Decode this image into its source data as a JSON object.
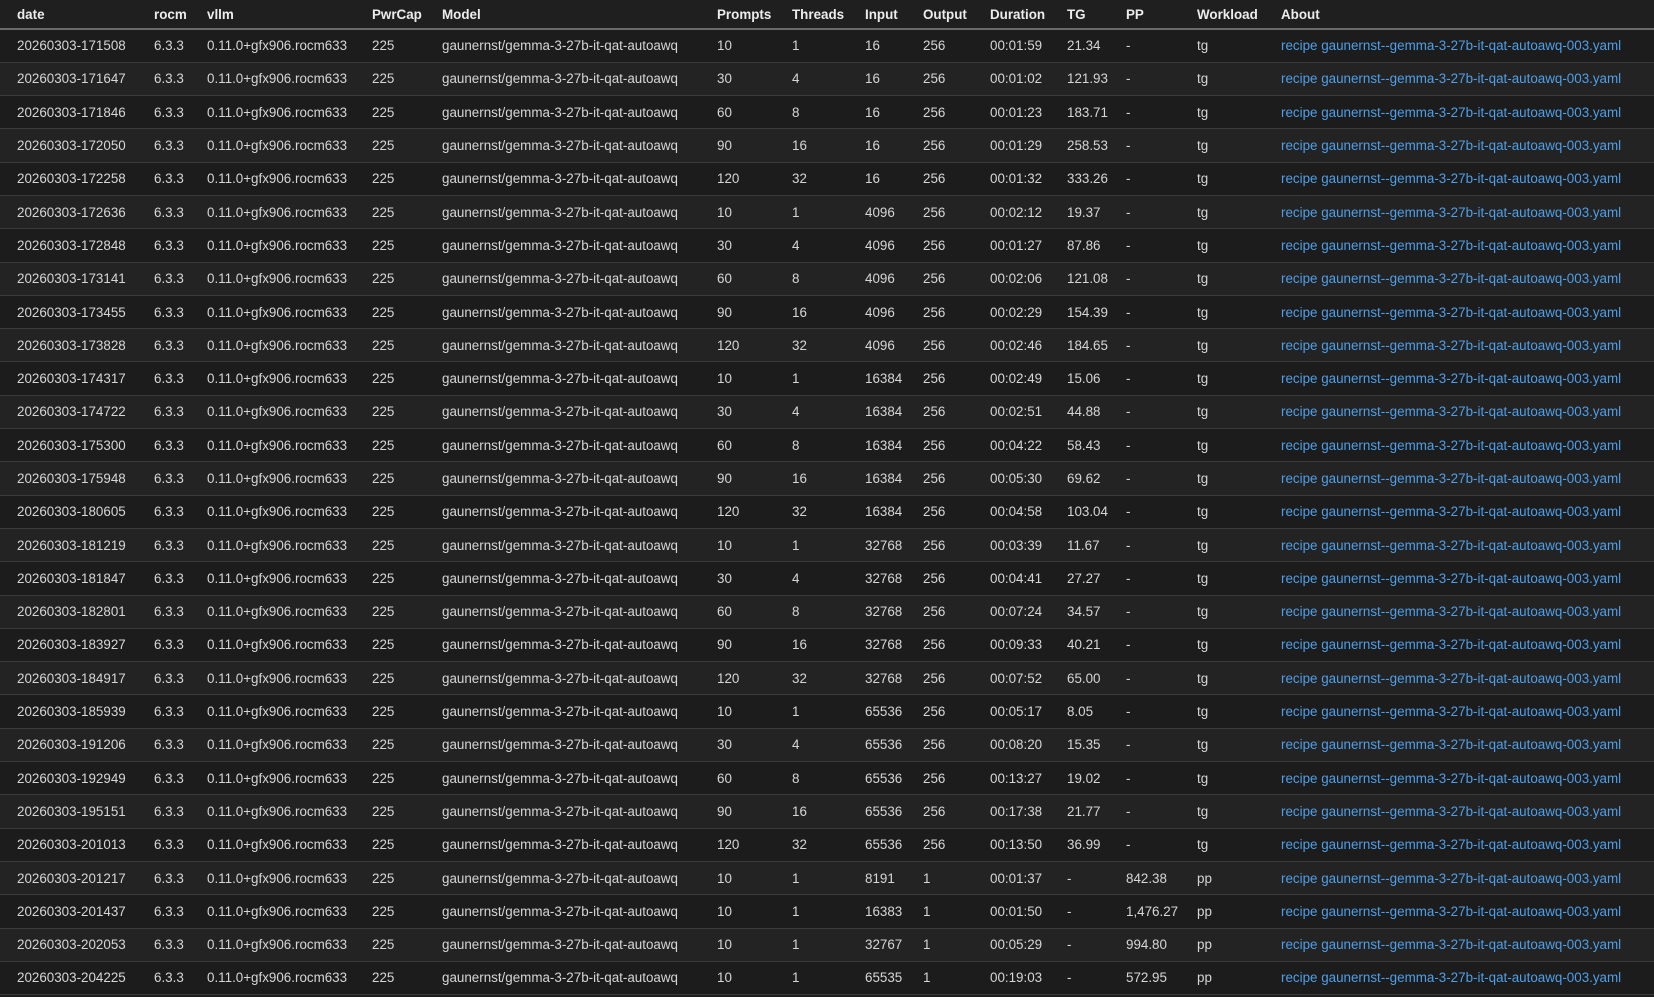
{
  "table": {
    "headers": [
      "date",
      "rocm",
      "vllm",
      "PwrCap",
      "Model",
      "Prompts",
      "Threads",
      "Input",
      "Output",
      "Duration",
      "TG",
      "PP",
      "Workload",
      "About"
    ],
    "rows": [
      [
        "20260303-171508",
        "6.3.3",
        "0.11.0+gfx906.rocm633",
        "225",
        "gaunernst/gemma-3-27b-it-qat-autoawq",
        "10",
        "1",
        "16",
        "256",
        "00:01:59",
        "21.34",
        "-",
        "tg",
        "recipe gaunernst--gemma-3-27b-it-qat-autoawq-003.yaml"
      ],
      [
        "20260303-171647",
        "6.3.3",
        "0.11.0+gfx906.rocm633",
        "225",
        "gaunernst/gemma-3-27b-it-qat-autoawq",
        "30",
        "4",
        "16",
        "256",
        "00:01:02",
        "121.93",
        "-",
        "tg",
        "recipe gaunernst--gemma-3-27b-it-qat-autoawq-003.yaml"
      ],
      [
        "20260303-171846",
        "6.3.3",
        "0.11.0+gfx906.rocm633",
        "225",
        "gaunernst/gemma-3-27b-it-qat-autoawq",
        "60",
        "8",
        "16",
        "256",
        "00:01:23",
        "183.71",
        "-",
        "tg",
        "recipe gaunernst--gemma-3-27b-it-qat-autoawq-003.yaml"
      ],
      [
        "20260303-172050",
        "6.3.3",
        "0.11.0+gfx906.rocm633",
        "225",
        "gaunernst/gemma-3-27b-it-qat-autoawq",
        "90",
        "16",
        "16",
        "256",
        "00:01:29",
        "258.53",
        "-",
        "tg",
        "recipe gaunernst--gemma-3-27b-it-qat-autoawq-003.yaml"
      ],
      [
        "20260303-172258",
        "6.3.3",
        "0.11.0+gfx906.rocm633",
        "225",
        "gaunernst/gemma-3-27b-it-qat-autoawq",
        "120",
        "32",
        "16",
        "256",
        "00:01:32",
        "333.26",
        "-",
        "tg",
        "recipe gaunernst--gemma-3-27b-it-qat-autoawq-003.yaml"
      ],
      [
        "20260303-172636",
        "6.3.3",
        "0.11.0+gfx906.rocm633",
        "225",
        "gaunernst/gemma-3-27b-it-qat-autoawq",
        "10",
        "1",
        "4096",
        "256",
        "00:02:12",
        "19.37",
        "-",
        "tg",
        "recipe gaunernst--gemma-3-27b-it-qat-autoawq-003.yaml"
      ],
      [
        "20260303-172848",
        "6.3.3",
        "0.11.0+gfx906.rocm633",
        "225",
        "gaunernst/gemma-3-27b-it-qat-autoawq",
        "30",
        "4",
        "4096",
        "256",
        "00:01:27",
        "87.86",
        "-",
        "tg",
        "recipe gaunernst--gemma-3-27b-it-qat-autoawq-003.yaml"
      ],
      [
        "20260303-173141",
        "6.3.3",
        "0.11.0+gfx906.rocm633",
        "225",
        "gaunernst/gemma-3-27b-it-qat-autoawq",
        "60",
        "8",
        "4096",
        "256",
        "00:02:06",
        "121.08",
        "-",
        "tg",
        "recipe gaunernst--gemma-3-27b-it-qat-autoawq-003.yaml"
      ],
      [
        "20260303-173455",
        "6.3.3",
        "0.11.0+gfx906.rocm633",
        "225",
        "gaunernst/gemma-3-27b-it-qat-autoawq",
        "90",
        "16",
        "4096",
        "256",
        "00:02:29",
        "154.39",
        "-",
        "tg",
        "recipe gaunernst--gemma-3-27b-it-qat-autoawq-003.yaml"
      ],
      [
        "20260303-173828",
        "6.3.3",
        "0.11.0+gfx906.rocm633",
        "225",
        "gaunernst/gemma-3-27b-it-qat-autoawq",
        "120",
        "32",
        "4096",
        "256",
        "00:02:46",
        "184.65",
        "-",
        "tg",
        "recipe gaunernst--gemma-3-27b-it-qat-autoawq-003.yaml"
      ],
      [
        "20260303-174317",
        "6.3.3",
        "0.11.0+gfx906.rocm633",
        "225",
        "gaunernst/gemma-3-27b-it-qat-autoawq",
        "10",
        "1",
        "16384",
        "256",
        "00:02:49",
        "15.06",
        "-",
        "tg",
        "recipe gaunernst--gemma-3-27b-it-qat-autoawq-003.yaml"
      ],
      [
        "20260303-174722",
        "6.3.3",
        "0.11.0+gfx906.rocm633",
        "225",
        "gaunernst/gemma-3-27b-it-qat-autoawq",
        "30",
        "4",
        "16384",
        "256",
        "00:02:51",
        "44.88",
        "-",
        "tg",
        "recipe gaunernst--gemma-3-27b-it-qat-autoawq-003.yaml"
      ],
      [
        "20260303-175300",
        "6.3.3",
        "0.11.0+gfx906.rocm633",
        "225",
        "gaunernst/gemma-3-27b-it-qat-autoawq",
        "60",
        "8",
        "16384",
        "256",
        "00:04:22",
        "58.43",
        "-",
        "tg",
        "recipe gaunernst--gemma-3-27b-it-qat-autoawq-003.yaml"
      ],
      [
        "20260303-175948",
        "6.3.3",
        "0.11.0+gfx906.rocm633",
        "225",
        "gaunernst/gemma-3-27b-it-qat-autoawq",
        "90",
        "16",
        "16384",
        "256",
        "00:05:30",
        "69.62",
        "-",
        "tg",
        "recipe gaunernst--gemma-3-27b-it-qat-autoawq-003.yaml"
      ],
      [
        "20260303-180605",
        "6.3.3",
        "0.11.0+gfx906.rocm633",
        "225",
        "gaunernst/gemma-3-27b-it-qat-autoawq",
        "120",
        "32",
        "16384",
        "256",
        "00:04:58",
        "103.04",
        "-",
        "tg",
        "recipe gaunernst--gemma-3-27b-it-qat-autoawq-003.yaml"
      ],
      [
        "20260303-181219",
        "6.3.3",
        "0.11.0+gfx906.rocm633",
        "225",
        "gaunernst/gemma-3-27b-it-qat-autoawq",
        "10",
        "1",
        "32768",
        "256",
        "00:03:39",
        "11.67",
        "-",
        "tg",
        "recipe gaunernst--gemma-3-27b-it-qat-autoawq-003.yaml"
      ],
      [
        "20260303-181847",
        "6.3.3",
        "0.11.0+gfx906.rocm633",
        "225",
        "gaunernst/gemma-3-27b-it-qat-autoawq",
        "30",
        "4",
        "32768",
        "256",
        "00:04:41",
        "27.27",
        "-",
        "tg",
        "recipe gaunernst--gemma-3-27b-it-qat-autoawq-003.yaml"
      ],
      [
        "20260303-182801",
        "6.3.3",
        "0.11.0+gfx906.rocm633",
        "225",
        "gaunernst/gemma-3-27b-it-qat-autoawq",
        "60",
        "8",
        "32768",
        "256",
        "00:07:24",
        "34.57",
        "-",
        "tg",
        "recipe gaunernst--gemma-3-27b-it-qat-autoawq-003.yaml"
      ],
      [
        "20260303-183927",
        "6.3.3",
        "0.11.0+gfx906.rocm633",
        "225",
        "gaunernst/gemma-3-27b-it-qat-autoawq",
        "90",
        "16",
        "32768",
        "256",
        "00:09:33",
        "40.21",
        "-",
        "tg",
        "recipe gaunernst--gemma-3-27b-it-qat-autoawq-003.yaml"
      ],
      [
        "20260303-184917",
        "6.3.3",
        "0.11.0+gfx906.rocm633",
        "225",
        "gaunernst/gemma-3-27b-it-qat-autoawq",
        "120",
        "32",
        "32768",
        "256",
        "00:07:52",
        "65.00",
        "-",
        "tg",
        "recipe gaunernst--gemma-3-27b-it-qat-autoawq-003.yaml"
      ],
      [
        "20260303-185939",
        "6.3.3",
        "0.11.0+gfx906.rocm633",
        "225",
        "gaunernst/gemma-3-27b-it-qat-autoawq",
        "10",
        "1",
        "65536",
        "256",
        "00:05:17",
        "8.05",
        "-",
        "tg",
        "recipe gaunernst--gemma-3-27b-it-qat-autoawq-003.yaml"
      ],
      [
        "20260303-191206",
        "6.3.3",
        "0.11.0+gfx906.rocm633",
        "225",
        "gaunernst/gemma-3-27b-it-qat-autoawq",
        "30",
        "4",
        "65536",
        "256",
        "00:08:20",
        "15.35",
        "-",
        "tg",
        "recipe gaunernst--gemma-3-27b-it-qat-autoawq-003.yaml"
      ],
      [
        "20260303-192949",
        "6.3.3",
        "0.11.0+gfx906.rocm633",
        "225",
        "gaunernst/gemma-3-27b-it-qat-autoawq",
        "60",
        "8",
        "65536",
        "256",
        "00:13:27",
        "19.02",
        "-",
        "tg",
        "recipe gaunernst--gemma-3-27b-it-qat-autoawq-003.yaml"
      ],
      [
        "20260303-195151",
        "6.3.3",
        "0.11.0+gfx906.rocm633",
        "225",
        "gaunernst/gemma-3-27b-it-qat-autoawq",
        "90",
        "16",
        "65536",
        "256",
        "00:17:38",
        "21.77",
        "-",
        "tg",
        "recipe gaunernst--gemma-3-27b-it-qat-autoawq-003.yaml"
      ],
      [
        "20260303-201013",
        "6.3.3",
        "0.11.0+gfx906.rocm633",
        "225",
        "gaunernst/gemma-3-27b-it-qat-autoawq",
        "120",
        "32",
        "65536",
        "256",
        "00:13:50",
        "36.99",
        "-",
        "tg",
        "recipe gaunernst--gemma-3-27b-it-qat-autoawq-003.yaml"
      ],
      [
        "20260303-201217",
        "6.3.3",
        "0.11.0+gfx906.rocm633",
        "225",
        "gaunernst/gemma-3-27b-it-qat-autoawq",
        "10",
        "1",
        "8191",
        "1",
        "00:01:37",
        "-",
        "842.38",
        "pp",
        "recipe gaunernst--gemma-3-27b-it-qat-autoawq-003.yaml"
      ],
      [
        "20260303-201437",
        "6.3.3",
        "0.11.0+gfx906.rocm633",
        "225",
        "gaunernst/gemma-3-27b-it-qat-autoawq",
        "10",
        "1",
        "16383",
        "1",
        "00:01:50",
        "-",
        "1,476.27",
        "pp",
        "recipe gaunernst--gemma-3-27b-it-qat-autoawq-003.yaml"
      ],
      [
        "20260303-202053",
        "6.3.3",
        "0.11.0+gfx906.rocm633",
        "225",
        "gaunernst/gemma-3-27b-it-qat-autoawq",
        "10",
        "1",
        "32767",
        "1",
        "00:05:29",
        "-",
        "994.80",
        "pp",
        "recipe gaunernst--gemma-3-27b-it-qat-autoawq-003.yaml"
      ],
      [
        "20260303-204225",
        "6.3.3",
        "0.11.0+gfx906.rocm633",
        "225",
        "gaunernst/gemma-3-27b-it-qat-autoawq",
        "10",
        "1",
        "65535",
        "1",
        "00:19:03",
        "-",
        "572.95",
        "pp",
        "recipe gaunernst--gemma-3-27b-it-qat-autoawq-003.yaml"
      ]
    ]
  },
  "colors": {
    "background": "#1f1f1f",
    "text": "#d6d6d6",
    "header_text": "#ececec",
    "link": "#4f9fe8",
    "row_border": "#3b3b3b"
  }
}
